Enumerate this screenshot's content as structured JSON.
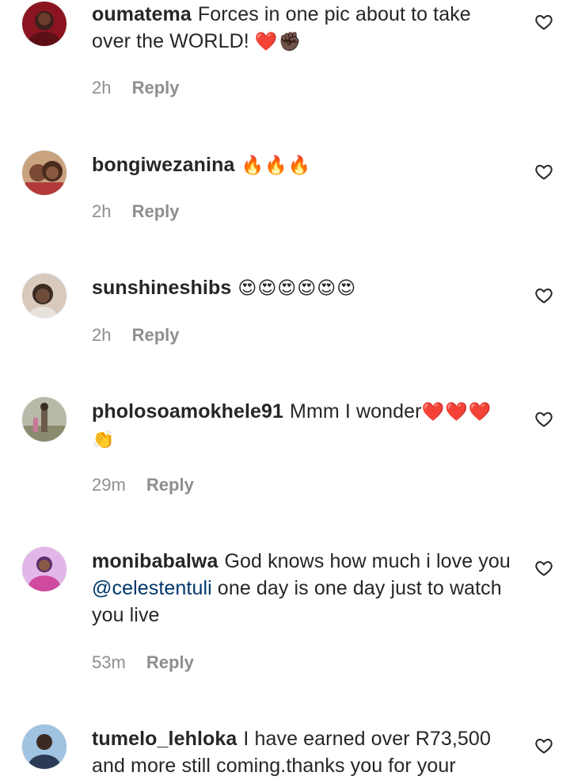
{
  "comments": [
    {
      "username": "oumatema",
      "text": "Forces in one pic about to take over the WORLD!",
      "emoji": "❤️✊🏿",
      "time": "2h",
      "reply_label": "Reply",
      "avatar_colors": [
        "#8a1520",
        "#3b1f1a"
      ]
    },
    {
      "username": "bongiwezanina",
      "text": "",
      "emoji": "🔥🔥🔥",
      "time": "2h",
      "reply_label": "Reply",
      "avatar_colors": [
        "#7a4a35",
        "#c9a27f"
      ]
    },
    {
      "username": "sunshineshibs",
      "text": "",
      "emoji": "😍😍😍😍😍😍",
      "time": "2h",
      "reply_label": "Reply",
      "avatar_colors": [
        "#d8c9bd",
        "#3a2a22"
      ]
    },
    {
      "username": "pholosoamokhele91",
      "text": "Mmm I wonder",
      "emoji": "❤️❤️❤️👏",
      "time": "29m",
      "reply_label": "Reply",
      "avatar_colors": [
        "#b8b9a8",
        "#6b5a4a"
      ]
    },
    {
      "username": "monibabalwa",
      "text_before": "God knows how much i love you ",
      "mention": "@celestentuli",
      "text_after": " one day is one day just to watch you live",
      "time": "53m",
      "reply_label": "Reply",
      "avatar_colors": [
        "#e2b6e8",
        "#5a2d6b"
      ]
    },
    {
      "username": "tumelo_lehloka",
      "text": "I have earned over R73,500 and more still coming.thanks you for your",
      "avatar_colors": [
        "#9fc3e0",
        "#2b3a55"
      ]
    }
  ],
  "icons": {
    "like": "heart-outline-icon"
  },
  "colors": {
    "text": "#262626",
    "meta": "#8e8e8e",
    "mention": "#00376b"
  }
}
